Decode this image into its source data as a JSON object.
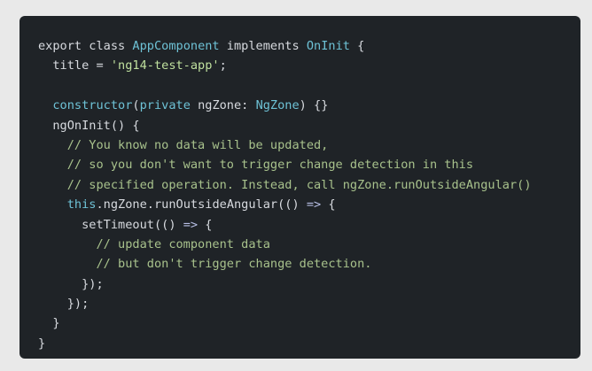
{
  "theme": {
    "background": "#e9e9e9",
    "card": "#1f2327",
    "text": "#d7dadf",
    "type": "#6ec2d6",
    "keyword": "#b7bfe4",
    "string": "#bfe09e",
    "comment": "#a8c28c"
  },
  "code": {
    "lines": [
      [
        {
          "text": "export class ",
          "kind": "plain"
        },
        {
          "text": "AppComponent",
          "kind": "type"
        },
        {
          "text": " implements ",
          "kind": "plain"
        },
        {
          "text": "OnInit",
          "kind": "type"
        },
        {
          "text": " {",
          "kind": "punct"
        }
      ],
      [
        {
          "text": "  title = ",
          "kind": "plain"
        },
        {
          "text": "'ng14-test-app'",
          "kind": "str"
        },
        {
          "text": ";",
          "kind": "punct"
        }
      ],
      [],
      [
        {
          "text": "  ",
          "kind": "plain"
        },
        {
          "text": "constructor",
          "kind": "type"
        },
        {
          "text": "(",
          "kind": "punct"
        },
        {
          "text": "private",
          "kind": "type"
        },
        {
          "text": " ngZone: ",
          "kind": "plain"
        },
        {
          "text": "NgZone",
          "kind": "type"
        },
        {
          "text": ") {}",
          "kind": "punct"
        }
      ],
      [
        {
          "text": "  ngOnInit() {",
          "kind": "plain"
        }
      ],
      [
        {
          "text": "    // You know no data will be updated,",
          "kind": "comment"
        }
      ],
      [
        {
          "text": "    // so you don't want to trigger change detection in this",
          "kind": "comment"
        }
      ],
      [
        {
          "text": "    // specified operation. Instead, call ngZone.runOutsideAngular()",
          "kind": "comment"
        }
      ],
      [
        {
          "text": "    ",
          "kind": "plain"
        },
        {
          "text": "this",
          "kind": "type"
        },
        {
          "text": ".ngZone.runOutsideAngular(() ",
          "kind": "plain"
        },
        {
          "text": "=>",
          "kind": "kw"
        },
        {
          "text": " {",
          "kind": "punct"
        }
      ],
      [
        {
          "text": "      setTimeout(() ",
          "kind": "plain"
        },
        {
          "text": "=>",
          "kind": "kw"
        },
        {
          "text": " {",
          "kind": "punct"
        }
      ],
      [
        {
          "text": "        // update component data",
          "kind": "comment"
        }
      ],
      [
        {
          "text": "        // but don't trigger change detection.",
          "kind": "comment"
        }
      ],
      [
        {
          "text": "      });",
          "kind": "plain"
        }
      ],
      [
        {
          "text": "    });",
          "kind": "plain"
        }
      ],
      [
        {
          "text": "  }",
          "kind": "plain"
        }
      ],
      [
        {
          "text": "}",
          "kind": "plain"
        }
      ]
    ]
  }
}
